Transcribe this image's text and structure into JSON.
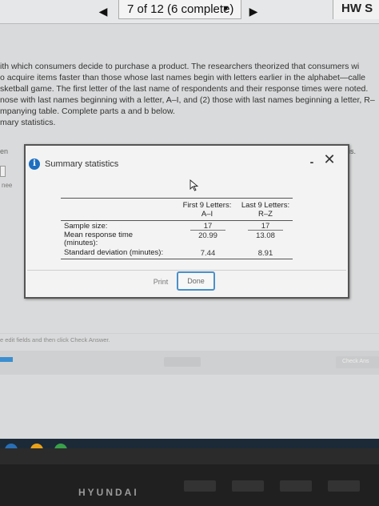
{
  "nav": {
    "progress_label": "7 of 12 (6 complete)",
    "hw_label": "HW S"
  },
  "question": {
    "lines": [
      "ith which consumers decide to purchase a product. The researchers theorized that consumers wi",
      "o acquire items faster than those whose last names begin with letters earlier in the alphabet—calle",
      "sketball game. The first letter of the last name of respondents and their response times were noted.",
      "nose with last names beginning with a letter, A–I, and (2) those with last names beginning a letter, R–",
      "mpanying table. Complete parts a and b below.",
      "mary statistics."
    ]
  },
  "background": {
    "frag_en": "en",
    "frag_ne": "nee",
    "frag_s": "is.",
    "hint": "e edit fields and then click Check Answer.",
    "check_answer": "Check Ans"
  },
  "dialog": {
    "title": "Summary statistics",
    "minimize": "-",
    "close": "✕",
    "columns": [
      {
        "header": "First 9 Letters:",
        "subheader": "A–I"
      },
      {
        "header": "Last 9 Letters:",
        "subheader": "R–Z"
      }
    ],
    "rows": [
      {
        "label": "Sample size:",
        "values": [
          "17",
          "17"
        ]
      },
      {
        "label": "Mean response time",
        "label2": "(minutes):",
        "values": [
          "20.99",
          "13.08"
        ]
      },
      {
        "label": "Standard deviation (minutes):",
        "values": [
          "7.44",
          "8.91"
        ]
      }
    ],
    "print_label": "Print",
    "done_label": "Done"
  },
  "laptop": {
    "brand": "HYUNDAI"
  }
}
